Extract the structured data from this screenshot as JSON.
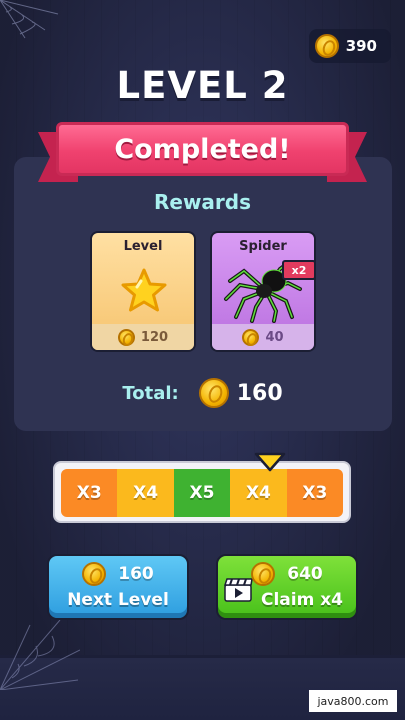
{
  "header": {
    "coin_count": "390"
  },
  "level_title": "LEVEL 2",
  "banner": {
    "text": "Completed!"
  },
  "rewards": {
    "label": "Rewards",
    "cards": [
      {
        "title": "Level",
        "icon": "star-icon",
        "coins": "120"
      },
      {
        "title": "Spider",
        "icon": "spider-icon",
        "badge": "x2",
        "coins": "40"
      }
    ],
    "total_label": "Total:",
    "total_value": "160"
  },
  "multiplier": {
    "segments": [
      "X3",
      "X4",
      "X5",
      "X4",
      "X3"
    ],
    "selected_index": 3
  },
  "buttons": {
    "next": {
      "amount": "160",
      "label": "Next Level"
    },
    "claim": {
      "amount": "640",
      "label": "Claim x4",
      "icon": "video-icon"
    }
  },
  "watermark": "java800.com",
  "colors": {
    "ribbon": "#f0426f",
    "next_button": "#2d9ddf",
    "claim_button": "#47c01a",
    "rewards_text": "#a9f0ef"
  }
}
